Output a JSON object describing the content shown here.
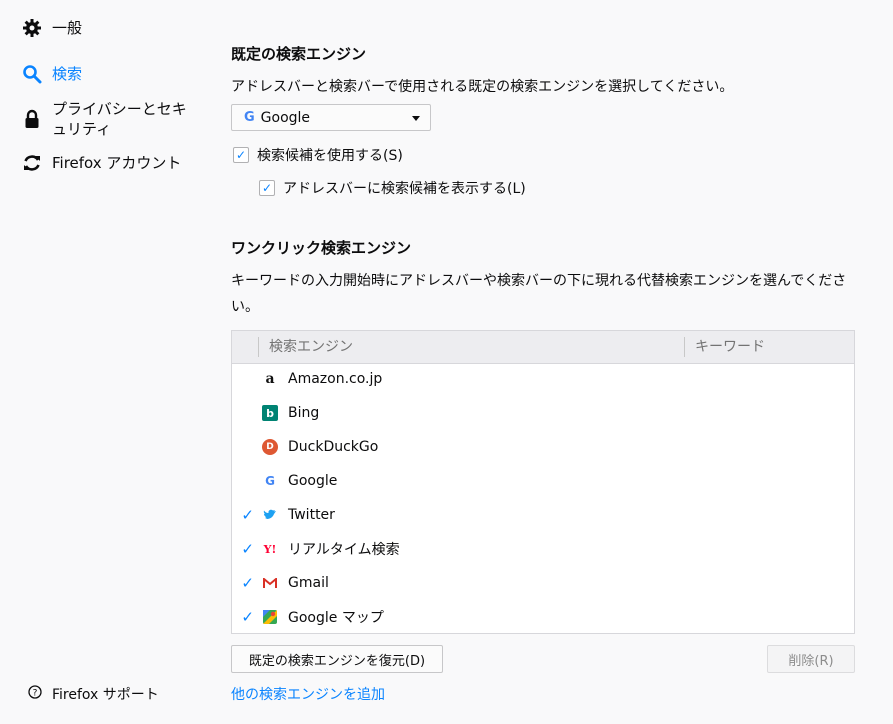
{
  "sidebar": {
    "items": [
      {
        "label": "一般",
        "icon": "gear-icon"
      },
      {
        "label": "検索",
        "icon": "search-icon",
        "selected": true
      },
      {
        "label": "プライバシーとセキュリティ",
        "icon": "lock-icon"
      },
      {
        "label": "Firefox アカウント",
        "icon": "sync-icon"
      }
    ],
    "support": {
      "label": "Firefox サポート",
      "icon": "help-icon"
    }
  },
  "default_engine": {
    "title": "既定の検索エンジン",
    "description": "アドレスバーと検索バーで使用される既定の検索エンジンを選択してください。",
    "selected_engine": "Google",
    "suggestions_label": "検索候補を使用する(S)",
    "suggestions_checked": true,
    "urlbar_suggestions_label": "アドレスバーに検索候補を表示する(L)",
    "urlbar_suggestions_checked": true
  },
  "oneclick": {
    "title": "ワンクリック検索エンジン",
    "description": "キーワードの入力開始時にアドレスバーや検索バーの下に現れる代替検索エンジンを選んでください。",
    "columns": {
      "engine": "検索エンジン",
      "keyword": "キーワード"
    },
    "engines": [
      {
        "name": "Amazon.co.jp",
        "checked": false,
        "icon": "amazon-icon"
      },
      {
        "name": "Bing",
        "checked": false,
        "icon": "bing-icon"
      },
      {
        "name": "DuckDuckGo",
        "checked": false,
        "icon": "duckduckgo-icon"
      },
      {
        "name": "Google",
        "checked": false,
        "icon": "google-icon"
      },
      {
        "name": "Twitter",
        "checked": true,
        "icon": "twitter-icon"
      },
      {
        "name": "リアルタイム検索",
        "checked": true,
        "icon": "yahoo-icon"
      },
      {
        "name": "Gmail",
        "checked": true,
        "icon": "gmail-icon"
      },
      {
        "name": "Google マップ",
        "checked": true,
        "icon": "google-maps-icon"
      }
    ],
    "restore_button": "既定の検索エンジンを復元(D)",
    "delete_button": "削除(R)",
    "add_link": "他の検索エンジンを追加"
  },
  "colors": {
    "accent": "#0a84ff",
    "background": "#f9f9fa"
  }
}
